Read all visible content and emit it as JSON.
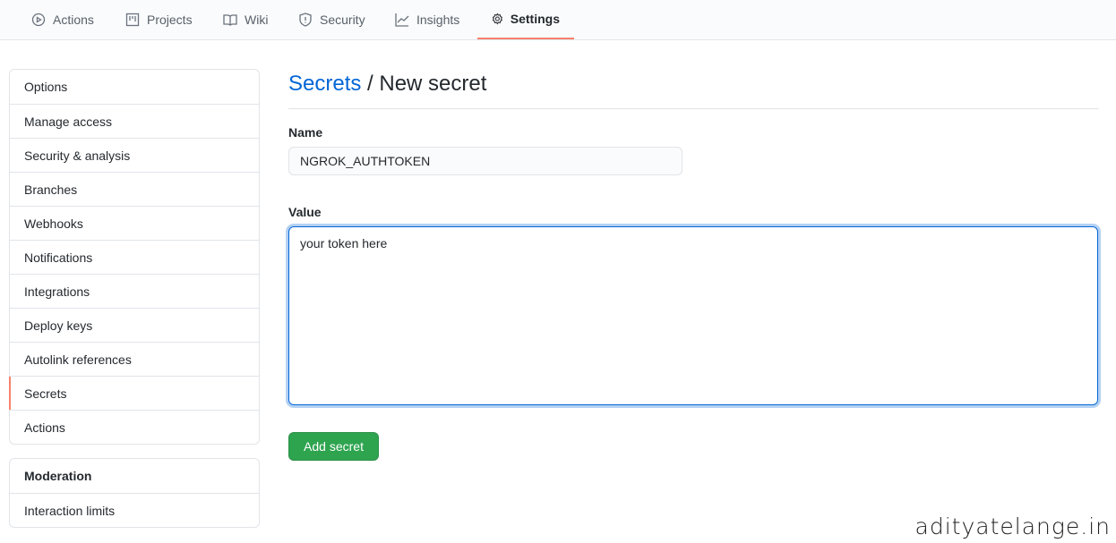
{
  "tabs": [
    {
      "label": "Actions",
      "icon": "play-circle-icon"
    },
    {
      "label": "Projects",
      "icon": "project-board-icon"
    },
    {
      "label": "Wiki",
      "icon": "book-icon"
    },
    {
      "label": "Security",
      "icon": "shield-icon"
    },
    {
      "label": "Insights",
      "icon": "graph-icon"
    },
    {
      "label": "Settings",
      "icon": "gear-icon",
      "selected": true
    }
  ],
  "sidebar": {
    "items": [
      "Options",
      "Manage access",
      "Security & analysis",
      "Branches",
      "Webhooks",
      "Notifications",
      "Integrations",
      "Deploy keys",
      "Autolink references",
      "Secrets",
      "Actions"
    ],
    "selected": "Secrets"
  },
  "moderation": {
    "heading": "Moderation",
    "items": [
      "Interaction limits"
    ]
  },
  "main": {
    "breadcrumb_link": "Secrets",
    "title_sep": " / New secret",
    "name_label": "Name",
    "name_value": "NGROK_AUTHTOKEN",
    "value_label": "Value",
    "value_text": "your token here",
    "submit": "Add secret"
  },
  "watermark": "adityatelange.in",
  "colors": {
    "accent": "#0366d6",
    "button": "#2ea44f",
    "selected_tab_underline": "#f9826c"
  }
}
